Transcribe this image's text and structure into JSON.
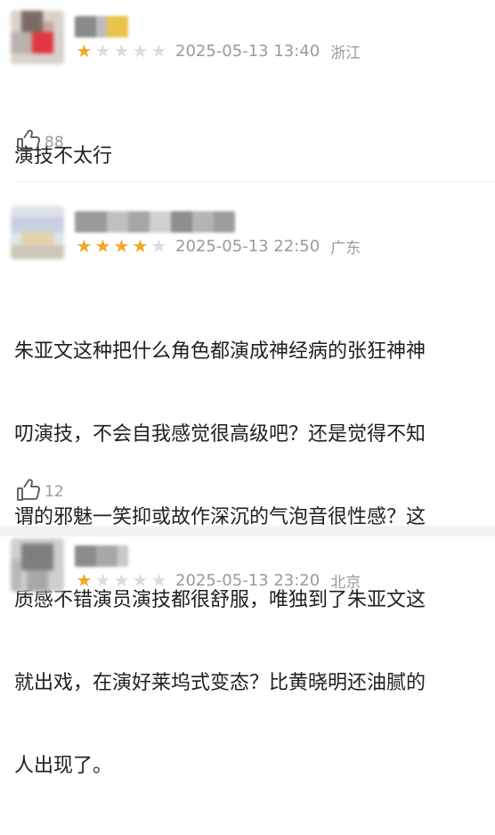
{
  "reviews": [
    {
      "rating": 1,
      "max_rating": 5,
      "date": "2025-05-13 13:40",
      "location": "浙江",
      "lines": [
        "演技不太行"
      ],
      "likes": "88"
    },
    {
      "rating": 4,
      "max_rating": 5,
      "date": "2025-05-13 22:50",
      "location": "广东",
      "lines": [
        "朱亚文这种把什么角色都演成神经病的张狂神神",
        "叨演技，不会自我感觉很高级吧？还是觉得不知",
        "谓的邪魅一笑抑或故作深沉的气泡音很性感？这",
        "质感不错演员演技都很舒服，唯独到了朱亚文这",
        "就出戏，在演好莱坞式变态？比黄晓明还油腻的",
        "人出现了。"
      ],
      "likes": "12"
    },
    {
      "rating": 1,
      "max_rating": 5,
      "date": "2025-05-13 23:20",
      "location": "北京"
    }
  ],
  "colors": {
    "star_on": "#f5a623",
    "star_off": "#dcdcdc",
    "meta_text": "#9a9a9a"
  },
  "icons": {
    "like": "thumbs-up-icon",
    "star": "star-icon"
  }
}
